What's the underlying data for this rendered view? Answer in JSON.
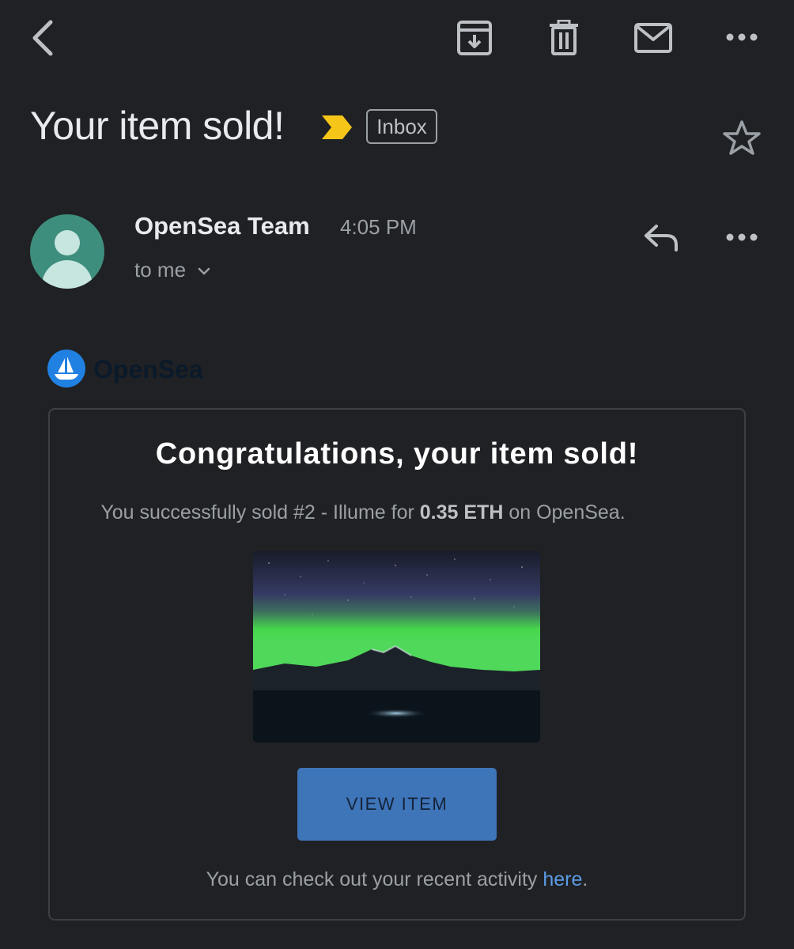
{
  "toolbar": {
    "back_icon": "back-arrow-icon",
    "archive_icon": "archive-icon",
    "delete_icon": "trash-icon",
    "mark_unread_icon": "mail-icon",
    "more_icon": "more-horizontal-icon"
  },
  "email": {
    "subject": "Your item sold!",
    "importance_color": "#f5c518",
    "label": "Inbox",
    "star_icon": "star-icon"
  },
  "sender": {
    "name": "OpenSea Team",
    "time": "4:05 PM",
    "recipient": "to me",
    "reply_icon": "reply-icon",
    "more_icon": "more-horizontal-icon",
    "avatar_color": "#3e8e7e"
  },
  "message": {
    "brand_name": "OpenSea",
    "brand_color": "#2081e2",
    "title": "Congratulations, your item sold!",
    "desc_prefix": "You successfully sold #2 - Illume for ",
    "desc_amount": "0.35 ETH",
    "desc_suffix": " on OpenSea.",
    "image_alt": "Aurora over mountains at night",
    "button_label": "VIEW ITEM",
    "footer_prefix": "You can check out your recent activity ",
    "footer_link": "here",
    "footer_suffix": "."
  }
}
